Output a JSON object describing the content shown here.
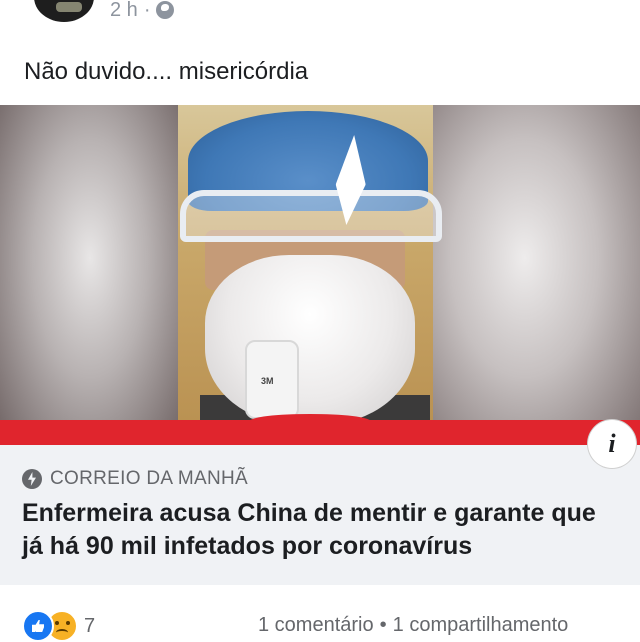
{
  "header": {
    "time": "2 h",
    "separator": "·",
    "icons": {
      "avatar": "profile-avatar",
      "privacy": "globe-icon"
    }
  },
  "post": {
    "text": "Não duvido.... misericórdia"
  },
  "media": {
    "description_icon": "info-icon",
    "info_label": "i",
    "mask_label": "3M"
  },
  "link_preview": {
    "source_icon": "bolt-icon",
    "source": "CORREIO DA MANHÃ",
    "headline": "Enfermeira acusa China de mentir e garante que já há 90 mil infetados por coronavírus"
  },
  "footer": {
    "reaction_icons": [
      "like-icon",
      "sad-icon"
    ],
    "reaction_count": "7",
    "comments": "1 comentário",
    "dot": "•",
    "shares": "1 compartilhamento"
  },
  "colors": {
    "reaction_like": "#1877f2",
    "reaction_sad": "#f7b125",
    "red_band": "#e0252d",
    "link_box_bg": "#f0f2f5"
  }
}
